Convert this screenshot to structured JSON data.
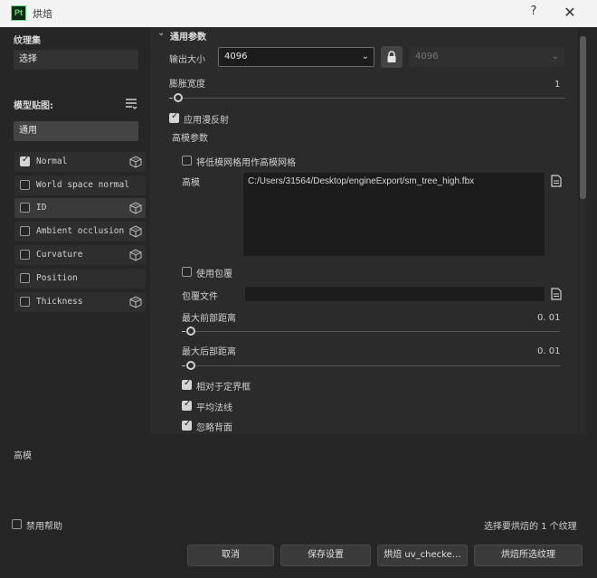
{
  "window": {
    "app_icon": "Pt",
    "title": "烘焙",
    "help_label": "?",
    "close_label": "✕"
  },
  "left": {
    "texture_set_label": "纹理集",
    "texture_set_value": "选择",
    "mesh_maps_label": "模型贴图:",
    "mesh_maps_filter": "通用",
    "maps": [
      {
        "label": "Normal",
        "checked": true,
        "icon": "cube-icon"
      },
      {
        "label": "World space normal",
        "checked": false,
        "icon": ""
      },
      {
        "label": "ID",
        "checked": false,
        "icon": "cube-icon"
      },
      {
        "label": "Ambient occlusion",
        "checked": false,
        "icon": "cube-icon"
      },
      {
        "label": "Curvature",
        "checked": false,
        "icon": "cube-icon"
      },
      {
        "label": "Position",
        "checked": false,
        "icon": ""
      },
      {
        "label": "Thickness",
        "checked": false,
        "icon": "cube-icon"
      }
    ]
  },
  "right": {
    "section_title": "通用参数",
    "output_size_label": "输出大小",
    "output_size_value": "4096",
    "output_size_locked_value": "4096",
    "dilation_label": "膨胀宽度",
    "dilation_value": "1",
    "apply_diffusion_label": "应用漫反射",
    "high_poly_params_label": "高模参数",
    "use_low_as_high_label": "将低模网格用作高模网格",
    "high_poly_label": "高模",
    "high_poly_path": "C:/Users/31564/Desktop/engineExport/sm_tree_high.fbx",
    "use_cage_label": "使用包覆",
    "cage_file_label": "包覆文件",
    "cage_file_value": "",
    "max_front_label": "最大前部距离",
    "max_front_value": "0. 01",
    "max_rear_label": "最大后部距离",
    "max_rear_value": "0. 01",
    "relative_bbox_label": "相对于定界框",
    "average_normals_label": "平均法线",
    "ignore_backface_label": "忽略背面",
    "dilation_fraction": 0.0,
    "front_fraction": 0.0,
    "rear_fraction": 0.0
  },
  "bottom": {
    "info_label": "高模",
    "disable_help_label": "禁用帮助",
    "status_text": "选择要烘焙的 1 个纹理",
    "cancel_label": "取消",
    "save_settings_label": "保存设置",
    "bake_one_label": "烘焙 uv_checke…",
    "bake_selected_label": "烘焙所选纹理"
  }
}
